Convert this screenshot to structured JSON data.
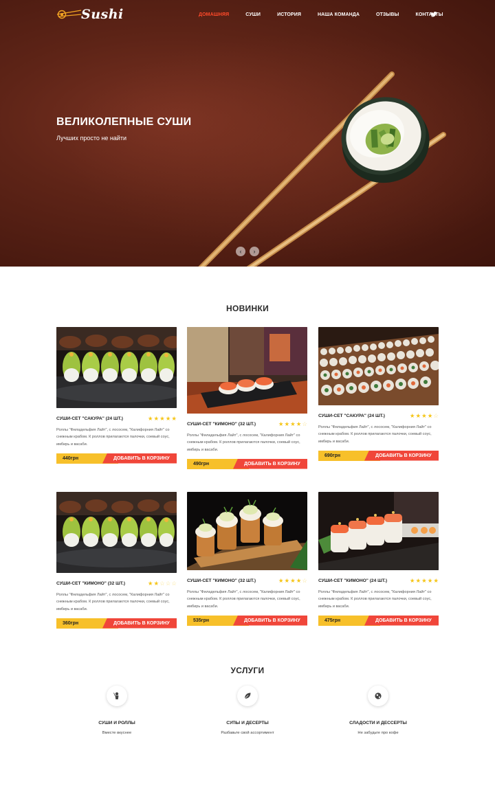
{
  "header": {
    "logo_text": "Sushi",
    "nav": [
      {
        "label": "Домашняя",
        "active": true
      },
      {
        "label": "Суши",
        "active": false
      },
      {
        "label": "История",
        "active": false
      },
      {
        "label": "Наша команда",
        "active": false
      },
      {
        "label": "Отзывы",
        "active": false
      },
      {
        "label": "Контакты",
        "active": false
      }
    ],
    "social_icon": "twitter-icon"
  },
  "hero": {
    "title": "ВЕЛИКОЛЕПНЫЕ СУШИ",
    "subtitle": "Лучших просто не найти",
    "prev_label": "‹",
    "next_label": "›"
  },
  "new_section": {
    "title": "НОВИНКИ",
    "cart_label": "ДОБАВИТЬ В КОРЗИНУ",
    "products": [
      {
        "name": "СУШИ-СЕТ \"САКУРА\" (24 ШТ.)",
        "rating": 5,
        "price": "440грн",
        "description": "Роллы \"Филадельфия Лайт\", с лососем, \"Калифорния Лайт\" со снежным крабом. К роллов прилагаются палочки, соевый соус, имбирь и васаби."
      },
      {
        "name": "СУШИ-СЕТ \"КИМОНО\" (32 ШТ.)",
        "rating": 4,
        "price": "490грн",
        "description": "Роллы \"Филадельфия Лайт\", с лососем, \"Калифорния Лайт\" со снежным крабом. К роллов прилагаются палочки, соевый соус, имбирь и васаби."
      },
      {
        "name": "СУШИ-СЕТ \"САКУРА\" (24 ШТ.)",
        "rating": 3.5,
        "price": "690грн",
        "description": "Роллы \"Филадельфия Лайт\", с лососем, \"Калифорния Лайт\" со снежным крабом. К роллов прилагаются палочки, соевый соус, имбирь и васаби."
      },
      {
        "name": "СУШИ-СЕТ \"КИМОНО\" (32 ШТ.)",
        "rating": 1.5,
        "price": "360грн",
        "description": "Роллы \"Филадельфия Лайт\", с лососем, \"Калифорния Лайт\" со снежным крабом. К роллов прилагаются палочки, соевый соус, имбирь и васаби."
      },
      {
        "name": "СУШИ-СЕТ \"КИМОНО\" (32 ШТ.)",
        "rating": 4,
        "price": "535грн",
        "description": "Роллы \"Филадельфия Лайт\", с лососем, \"Калифорния Лайт\" со снежным крабом. К роллов прилагаются палочки, соевый соус, имбирь и васаби."
      },
      {
        "name": "СУШИ-СЕТ \"КИМОНО\" (24 ШТ.)",
        "rating": 5,
        "price": "475грн",
        "description": "Роллы \"Филадельфия Лайт\", с лососем, \"Калифорния Лайт\" со снежным крабом. К роллов прилагаются палочки, соевый соус, имбирь и васаби."
      }
    ]
  },
  "services": {
    "title": "УСЛУГИ",
    "items": [
      {
        "icon": "chef-icon",
        "title": "СУШИ И РОЛЛЫ",
        "subtitle": "Вместе вкуснее"
      },
      {
        "icon": "leaf-icon",
        "title": "СУПЫ И ДЕСЕРТЫ",
        "subtitle": "Разбавьте свой ассортимент"
      },
      {
        "icon": "globe-icon",
        "title": "СЛАДОСТИ И ДЕССЕРТЫ",
        "subtitle": "Не забудьте про кофе"
      }
    ]
  },
  "colors": {
    "accent_red": "#f0463a",
    "accent_yellow": "#f7c02a",
    "star": "#f5c518",
    "nav_active": "#ff4a2a"
  }
}
